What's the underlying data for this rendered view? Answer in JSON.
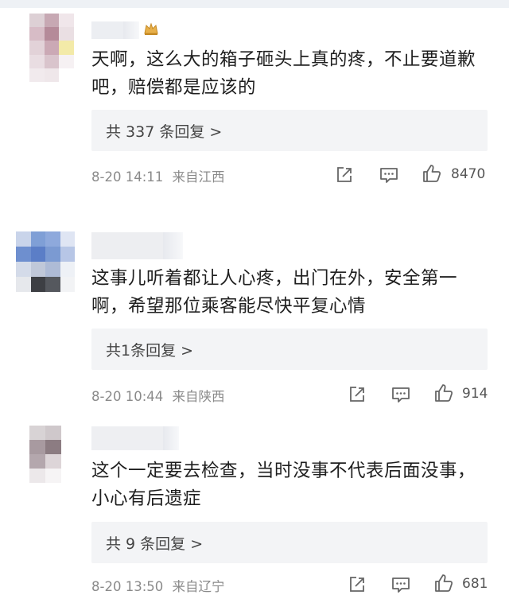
{
  "comments": [
    {
      "text": "天啊，这么大的箱子砸头上真的疼，不止要道歉吧，赔偿都是应该的",
      "replies_label": "共 337 条回复 >",
      "timestamp": "8-20 14:11",
      "location": "来自江西",
      "likes": "8470",
      "has_badge": true
    },
    {
      "text": "这事儿听着都让人心疼，出门在外，安全第一啊，希望那位乘客能尽快平复心情",
      "replies_label": "共1条回复 >",
      "timestamp": "8-20 10:44",
      "location": "来自陕西",
      "likes": "914",
      "has_badge": false
    },
    {
      "text": "这个一定要去检查，当时没事不代表后面没事，小心有后遗症",
      "replies_label": "共 9 条回复 >",
      "timestamp": "8-20 13:50",
      "location": "来自辽宁",
      "likes": "681",
      "has_badge": false
    }
  ],
  "colors": {
    "text": "#1f1f1f",
    "meta": "#8a8a8a",
    "reply_bg": "#f3f4f6",
    "icon": "#666666",
    "badge": "#e8b04a"
  },
  "icons": [
    "share-icon",
    "comment-icon",
    "like-icon",
    "vip-badge-icon"
  ]
}
